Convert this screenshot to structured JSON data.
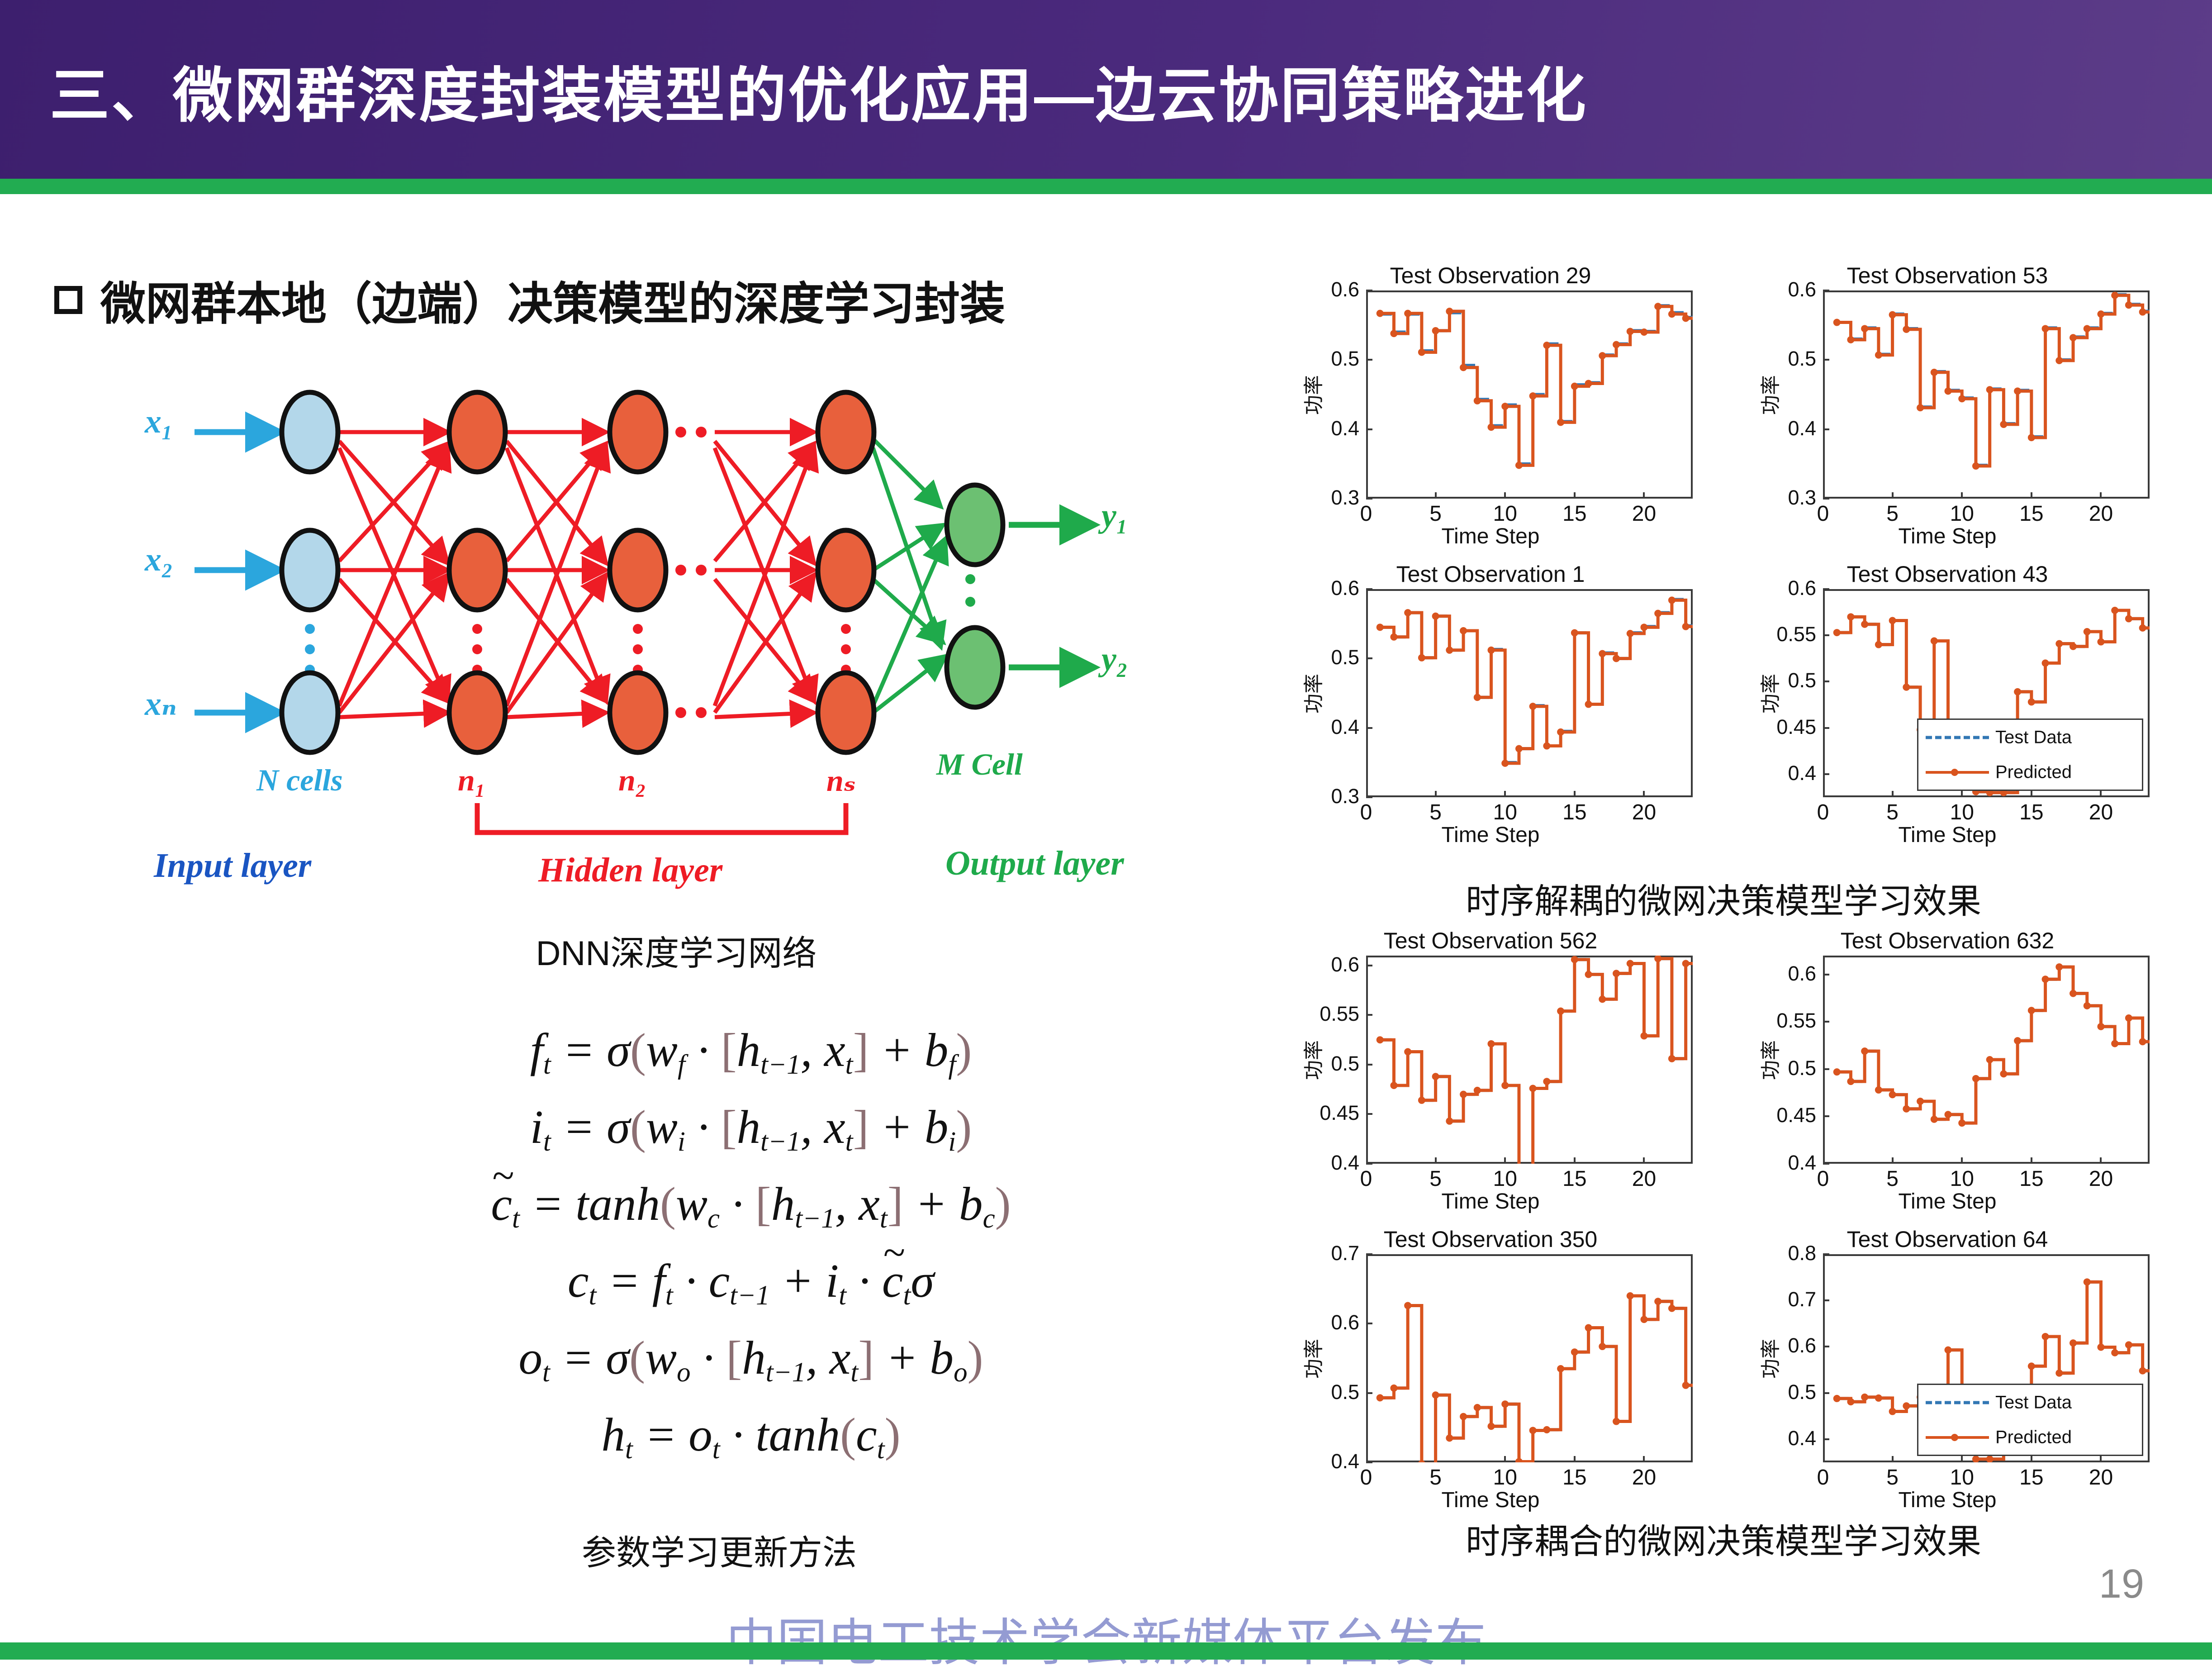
{
  "header": {
    "title": "三、微网群深度封装模型的优化应用—边云协同策略进化",
    "band_color": "#3d1f6e",
    "rule_color": "#22ac51"
  },
  "left": {
    "bullet_heading": "微网群本地（边端）决策模型的深度学习封装",
    "diagram_caption": "DNN深度学习网络",
    "formula_caption": "参数学习更新方法",
    "dnn": {
      "input_labels": [
        "x₁",
        "x₂",
        "xₙ"
      ],
      "output_labels": [
        "y₁",
        "y₂"
      ],
      "layer_names": [
        "N cells",
        "n₁",
        "n₂",
        "nₛ",
        "M Cell"
      ],
      "zone_labels": [
        "Input layer",
        "Hidden layer",
        "Output layer"
      ],
      "colors": {
        "input_node": "#b3d7ea",
        "hidden_node": "#e8603c",
        "output_node": "#6cc072",
        "input_arrow": "#2ba6dd",
        "hidden_arrow": "#ee1c25",
        "output_arrow": "#1faa4b",
        "input_text": "#2ba6dd",
        "hidden_text": "#ee1c25",
        "output_text": "#1faa4b"
      }
    },
    "equations": [
      "f_t = σ(w_f · [h_{t−1}, x_t] + b_f)",
      "i_t = σ(w_i · [h_{t−1}, x_t] + b_i)",
      "c̃_t = tanh(w_c · [h_{t−1}, x_t] + b_c)",
      "c_t = f_t · c_{t−1} + i_t · c̃_t σ",
      "o_t = σ(w_o · [h_{t−1}, x_t] + b_o)",
      "h_t = o_t · tanh(c_t)"
    ]
  },
  "right": {
    "group1_caption": "时序解耦的微网决策模型学习效果",
    "group2_caption": "时序耦合的微网决策模型学习效果",
    "legend": {
      "test_data": "Test Data",
      "predicted": "Predicted"
    },
    "colors": {
      "test_data": "#3277b4",
      "predicted": "#d9541e"
    }
  },
  "footer": {
    "page_number": "19",
    "watermark": "中国电工技术学会新媒体平台发布"
  },
  "chart_data": [
    {
      "type": "line",
      "title": "Test Observation 29",
      "xlabel": "Time Step",
      "ylabel": "功率",
      "xlim": [
        0,
        23.5
      ],
      "ylim": [
        0.3,
        0.6
      ],
      "xticks": [
        0,
        5,
        10,
        15,
        20
      ],
      "yticks": [
        0.3,
        0.4,
        0.5,
        0.6
      ],
      "grid": false,
      "legend": null,
      "x": [
        1,
        2,
        3,
        4,
        5,
        6,
        7,
        8,
        9,
        10,
        11,
        12,
        13,
        14,
        15,
        16,
        17,
        18,
        19,
        20,
        21,
        22,
        23
      ],
      "series": [
        {
          "name": "Test Data",
          "values": [
            0.566,
            0.54,
            0.566,
            0.513,
            0.542,
            0.568,
            0.492,
            0.443,
            0.405,
            0.435,
            0.35,
            0.45,
            0.523,
            0.411,
            0.464,
            0.467,
            0.507,
            0.523,
            0.542,
            0.541,
            0.578,
            0.568,
            0.561
          ]
        },
        {
          "name": "Predicted",
          "values": [
            0.567,
            0.538,
            0.567,
            0.511,
            0.542,
            0.57,
            0.489,
            0.441,
            0.403,
            0.433,
            0.348,
            0.448,
            0.521,
            0.41,
            0.462,
            0.466,
            0.506,
            0.522,
            0.541,
            0.54,
            0.577,
            0.566,
            0.56
          ]
        }
      ]
    },
    {
      "type": "line",
      "title": "Test Observation 53",
      "xlabel": "Time Step",
      "ylabel": "功率",
      "xlim": [
        0,
        23.5
      ],
      "ylim": [
        0.3,
        0.6
      ],
      "xticks": [
        0,
        5,
        10,
        15,
        20
      ],
      "yticks": [
        0.3,
        0.4,
        0.5,
        0.6
      ],
      "grid": false,
      "legend": null,
      "x": [
        1,
        2,
        3,
        4,
        5,
        6,
        7,
        8,
        9,
        10,
        11,
        12,
        13,
        14,
        15,
        16,
        17,
        18,
        19,
        20,
        21,
        22,
        23
      ],
      "series": [
        {
          "name": "Test Data",
          "values": [
            0.554,
            0.53,
            0.546,
            0.508,
            0.566,
            0.545,
            0.432,
            0.483,
            0.456,
            0.445,
            0.348,
            0.458,
            0.408,
            0.456,
            0.389,
            0.546,
            0.5,
            0.533,
            0.546,
            0.567,
            0.594,
            0.58,
            0.57
          ]
        },
        {
          "name": "Predicted",
          "values": [
            0.554,
            0.529,
            0.545,
            0.507,
            0.565,
            0.544,
            0.431,
            0.482,
            0.455,
            0.444,
            0.347,
            0.457,
            0.407,
            0.455,
            0.388,
            0.545,
            0.499,
            0.532,
            0.545,
            0.566,
            0.593,
            0.579,
            0.569
          ]
        }
      ]
    },
    {
      "type": "line",
      "title": "Test Observation 1",
      "xlabel": "Time Step",
      "ylabel": "功率",
      "xlim": [
        0,
        23.5
      ],
      "ylim": [
        0.3,
        0.6
      ],
      "xticks": [
        0,
        5,
        10,
        15,
        20
      ],
      "yticks": [
        0.3,
        0.4,
        0.5,
        0.6
      ],
      "grid": false,
      "legend": null,
      "x": [
        1,
        2,
        3,
        4,
        5,
        6,
        7,
        8,
        9,
        10,
        11,
        12,
        13,
        14,
        15,
        16,
        17,
        18,
        19,
        20,
        21,
        22,
        23
      ],
      "series": [
        {
          "name": "Test Data",
          "values": [
            0.545,
            0.531,
            0.566,
            0.501,
            0.561,
            0.512,
            0.54,
            0.444,
            0.513,
            0.35,
            0.37,
            0.432,
            0.374,
            0.395,
            0.537,
            0.434,
            0.508,
            0.5,
            0.537,
            0.546,
            0.566,
            0.585,
            0.547
          ]
        },
        {
          "name": "Predicted",
          "values": [
            0.545,
            0.531,
            0.566,
            0.501,
            0.561,
            0.512,
            0.54,
            0.444,
            0.512,
            0.349,
            0.37,
            0.431,
            0.374,
            0.394,
            0.537,
            0.434,
            0.507,
            0.5,
            0.536,
            0.545,
            0.565,
            0.584,
            0.546
          ]
        }
      ]
    },
    {
      "type": "line",
      "title": "Test Observation 43",
      "xlabel": "Time Step",
      "ylabel": "功率",
      "xlim": [
        0,
        23.5
      ],
      "ylim": [
        0.375,
        0.6
      ],
      "xticks": [
        0,
        5,
        10,
        15,
        20
      ],
      "yticks": [
        0.4,
        0.45,
        0.5,
        0.55,
        0.6
      ],
      "grid": false,
      "legend": "inside-lower-right",
      "x": [
        1,
        2,
        3,
        4,
        5,
        6,
        7,
        8,
        9,
        10,
        11,
        12,
        13,
        14,
        15,
        16,
        17,
        18,
        19,
        20,
        21,
        22,
        23
      ],
      "series": [
        {
          "name": "Test Data",
          "values": [
            0.553,
            0.57,
            0.562,
            0.54,
            0.566,
            0.494,
            0.448,
            0.544,
            0.43,
            0.4,
            0.381,
            0.38,
            0.38,
            0.489,
            0.478,
            0.52,
            0.541,
            0.538,
            0.554,
            0.543,
            0.577,
            0.568,
            0.558
          ]
        },
        {
          "name": "Predicted",
          "values": [
            0.553,
            0.57,
            0.562,
            0.54,
            0.566,
            0.494,
            0.448,
            0.544,
            0.43,
            0.4,
            0.381,
            0.38,
            0.38,
            0.489,
            0.478,
            0.52,
            0.541,
            0.538,
            0.554,
            0.543,
            0.577,
            0.568,
            0.558
          ]
        }
      ]
    },
    {
      "type": "line",
      "title": "Test Observation 562",
      "xlabel": "Time Step",
      "ylabel": "功率",
      "xlim": [
        0,
        23.5
      ],
      "ylim": [
        0.4,
        0.61
      ],
      "xticks": [
        0,
        5,
        10,
        15,
        20
      ],
      "yticks": [
        0.4,
        0.45,
        0.5,
        0.55,
        0.6
      ],
      "grid": false,
      "legend": null,
      "x": [
        1,
        2,
        3,
        4,
        5,
        6,
        7,
        8,
        9,
        10,
        11,
        12,
        13,
        14,
        15,
        16,
        17,
        18,
        19,
        20,
        21,
        22,
        23
      ],
      "series": [
        {
          "name": "Test Data",
          "values": [
            0.525,
            0.479,
            0.513,
            0.464,
            0.488,
            0.443,
            0.47,
            0.474,
            0.521,
            0.479,
            0.394,
            0.476,
            0.483,
            0.554,
            0.606,
            0.591,
            0.566,
            0.592,
            0.602,
            0.529,
            0.607,
            0.506,
            0.602
          ]
        },
        {
          "name": "Predicted",
          "values": [
            0.525,
            0.479,
            0.513,
            0.464,
            0.488,
            0.443,
            0.47,
            0.474,
            0.521,
            0.479,
            0.394,
            0.476,
            0.483,
            0.554,
            0.606,
            0.591,
            0.566,
            0.592,
            0.602,
            0.529,
            0.607,
            0.506,
            0.602
          ]
        }
      ]
    },
    {
      "type": "line",
      "title": "Test Observation 632",
      "xlabel": "Time Step",
      "ylabel": "功率",
      "xlim": [
        0,
        23.5
      ],
      "ylim": [
        0.4,
        0.62
      ],
      "xticks": [
        0,
        5,
        10,
        15,
        20
      ],
      "yticks": [
        0.4,
        0.45,
        0.5,
        0.55,
        0.6
      ],
      "grid": false,
      "legend": null,
      "x": [
        1,
        2,
        3,
        4,
        5,
        6,
        7,
        8,
        9,
        10,
        11,
        12,
        13,
        14,
        15,
        16,
        17,
        18,
        19,
        20,
        21,
        22,
        23
      ],
      "series": [
        {
          "name": "Test Data",
          "values": [
            0.497,
            0.487,
            0.519,
            0.478,
            0.473,
            0.458,
            0.466,
            0.447,
            0.452,
            0.443,
            0.49,
            0.51,
            0.495,
            0.53,
            0.562,
            0.595,
            0.608,
            0.58,
            0.567,
            0.545,
            0.527,
            0.554,
            0.529
          ]
        },
        {
          "name": "Predicted",
          "values": [
            0.497,
            0.487,
            0.519,
            0.478,
            0.473,
            0.458,
            0.466,
            0.447,
            0.452,
            0.443,
            0.49,
            0.51,
            0.495,
            0.53,
            0.562,
            0.595,
            0.608,
            0.58,
            0.567,
            0.545,
            0.527,
            0.554,
            0.529
          ]
        }
      ]
    },
    {
      "type": "line",
      "title": "Test Observation 350",
      "xlabel": "Time Step",
      "ylabel": "功率",
      "xlim": [
        0,
        23.5
      ],
      "ylim": [
        0.4,
        0.7
      ],
      "xticks": [
        0,
        5,
        10,
        15,
        20
      ],
      "yticks": [
        0.4,
        0.5,
        0.6,
        0.7
      ],
      "grid": false,
      "legend": null,
      "x": [
        1,
        2,
        3,
        4,
        5,
        6,
        7,
        8,
        9,
        10,
        11,
        12,
        13,
        14,
        15,
        16,
        17,
        18,
        19,
        20,
        21,
        22,
        23
      ],
      "series": [
        {
          "name": "Test Data",
          "values": [
            0.493,
            0.507,
            0.626,
            0.398,
            0.497,
            0.435,
            0.466,
            0.479,
            0.452,
            0.484,
            0.401,
            0.446,
            0.447,
            0.535,
            0.559,
            0.594,
            0.567,
            0.459,
            0.64,
            0.606,
            0.632,
            0.622,
            0.511
          ]
        },
        {
          "name": "Predicted",
          "values": [
            0.493,
            0.507,
            0.626,
            0.398,
            0.497,
            0.435,
            0.466,
            0.479,
            0.452,
            0.484,
            0.401,
            0.446,
            0.447,
            0.535,
            0.559,
            0.594,
            0.567,
            0.459,
            0.64,
            0.606,
            0.632,
            0.622,
            0.511
          ]
        }
      ]
    },
    {
      "type": "line",
      "title": "Test Observation 64",
      "xlabel": "Time Step",
      "ylabel": "功率",
      "xlim": [
        0,
        23.5
      ],
      "ylim": [
        0.35,
        0.8
      ],
      "xticks": [
        0,
        5,
        10,
        15,
        20
      ],
      "yticks": [
        0.4,
        0.5,
        0.6,
        0.7,
        0.8
      ],
      "grid": false,
      "legend": "inside-lower-right",
      "x": [
        1,
        2,
        3,
        4,
        5,
        6,
        7,
        8,
        9,
        10,
        11,
        12,
        13,
        14,
        15,
        16,
        17,
        18,
        19,
        20,
        21,
        22,
        23
      ],
      "series": [
        {
          "name": "Test Data",
          "values": [
            0.488,
            0.481,
            0.491,
            0.489,
            0.46,
            0.472,
            0.491,
            0.405,
            0.593,
            0.425,
            0.357,
            0.357,
            0.488,
            0.507,
            0.558,
            0.622,
            0.543,
            0.608,
            0.74,
            0.599,
            0.587,
            0.604,
            0.548
          ]
        },
        {
          "name": "Predicted",
          "values": [
            0.488,
            0.481,
            0.491,
            0.489,
            0.46,
            0.472,
            0.491,
            0.405,
            0.593,
            0.425,
            0.357,
            0.357,
            0.488,
            0.507,
            0.558,
            0.622,
            0.543,
            0.608,
            0.74,
            0.599,
            0.587,
            0.604,
            0.548
          ]
        }
      ]
    }
  ]
}
